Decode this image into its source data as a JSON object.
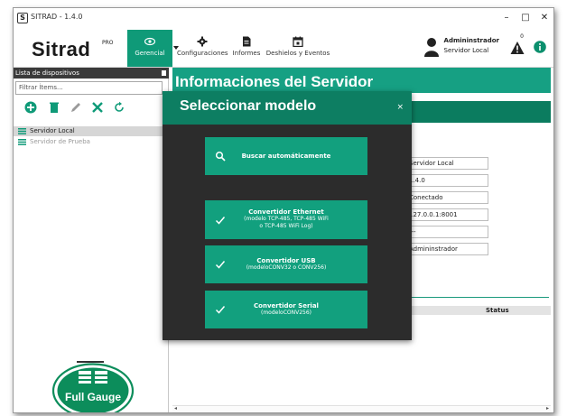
{
  "window": {
    "title": "SITRAD - 1.4.0",
    "app_icon": "S"
  },
  "controls": {
    "minimize": "–",
    "maximize": "□",
    "close": "✕"
  },
  "ribbon": {
    "logo": "Sitrad",
    "logo_sup": "PRO",
    "tabs": [
      {
        "label": "Gerencial",
        "icon": "eye-icon"
      },
      {
        "label": "Configuraciones",
        "icon": "gear-icon"
      },
      {
        "label": "Informes",
        "icon": "document-icon"
      },
      {
        "label": "Deshielos y Eventos",
        "icon": "calendar-icon"
      }
    ],
    "user_name": "Admininstrador",
    "user_role": "Servidor Local",
    "alert_count": "0"
  },
  "sidebar": {
    "header": "Lista de dispositivos",
    "filter_placeholder": "Filtrar Ítems...",
    "devices": [
      {
        "label": "Servidor Local",
        "selected": true
      },
      {
        "label": "Servidor de Prueba",
        "selected": false
      }
    ],
    "logo_text": "Full Gauge"
  },
  "main": {
    "title": "Informaciones del Servidor",
    "fields": [
      "Servidor Local",
      "1.4.0",
      "Conectado",
      "127.0.0.1:8001",
      "---",
      "Admininstrador"
    ],
    "table_status_header": "Status"
  },
  "modal": {
    "title": "Seleccionar modelo",
    "close": "×",
    "search_button": "Buscar automáticamente",
    "options": [
      {
        "label": "Convertidor Ethernet",
        "sub1": "(modelo TCP-485, TCP-485 WiFi",
        "sub2": "o TCP-485 WiFi Log)"
      },
      {
        "label": "Convertidor USB",
        "sub1": "(modeloCONV32 o CONV256)",
        "sub2": ""
      },
      {
        "label": "Convertidor Serial",
        "sub1": "(modeloCONV256)",
        "sub2": ""
      }
    ]
  },
  "colors": {
    "accent": "#16a083",
    "dark_accent": "#0d7e62",
    "modal_bg": "#2c2c2c"
  }
}
